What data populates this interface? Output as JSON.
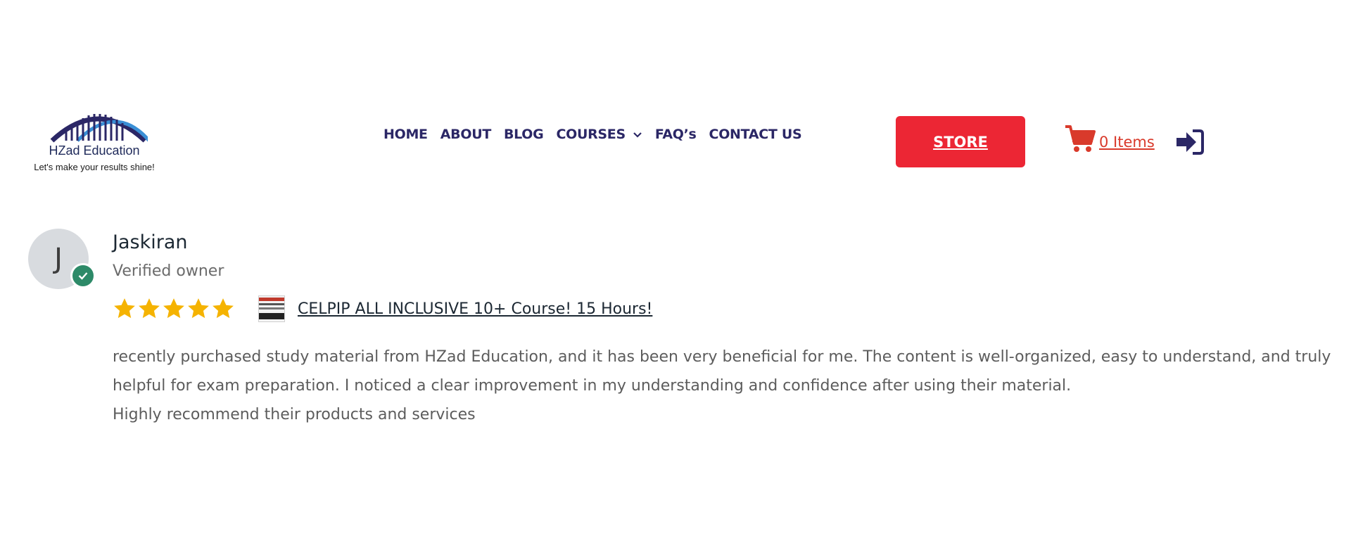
{
  "header": {
    "logo": {
      "brand_name": "HZad Education",
      "tagline": "Let's make your results shine!"
    },
    "nav": [
      {
        "label": "HOME"
      },
      {
        "label": "ABOUT"
      },
      {
        "label": "BLOG"
      },
      {
        "label": "COURSES",
        "icon": "chevron-down-icon"
      },
      {
        "label": "FAQ’s"
      },
      {
        "label": "CONTACT US"
      }
    ],
    "store_button": "STORE",
    "cart": {
      "icon": "cart-icon",
      "label": "0 Items"
    },
    "login": {
      "icon": "sign-in-icon"
    }
  },
  "review": {
    "avatar_initial": "J",
    "reviewer_name": "Jaskiran",
    "reviewer_status": "Verified owner",
    "rating": 5,
    "rating_max": 5,
    "product_title": "CELPIP ALL INCLUSIVE 10+ Course! 15 Hours!",
    "body": [
      "recently purchased study material from HZad Education, and it has been very beneficial for me. The content is well-organized, easy to understand, and truly helpful for exam preparation. I noticed a clear improvement in my understanding and confidence after using their material.",
      "Highly recommend their products and services"
    ]
  },
  "colors": {
    "nav_text": "#2b2766",
    "store_button": "#ec2634",
    "cart": "#d93a2b",
    "star": "#f5b301",
    "verified_badge": "#2d8a68"
  }
}
